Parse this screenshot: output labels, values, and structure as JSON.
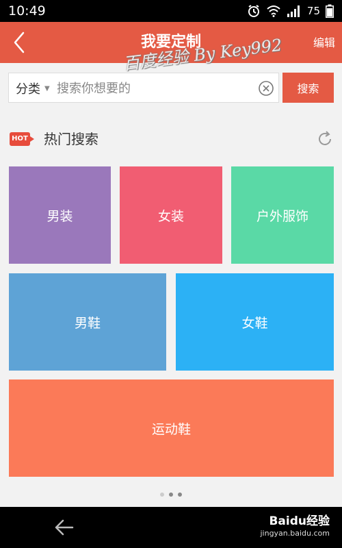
{
  "status_bar": {
    "time": "10:49",
    "battery": "75"
  },
  "header": {
    "title": "我要定制",
    "edit_label": "编辑"
  },
  "search": {
    "category": "分类",
    "placeholder": "搜索你想要的",
    "value": "",
    "button_label": "搜索"
  },
  "hot_section": {
    "badge": "HOT",
    "title": "热门搜索"
  },
  "categories": [
    {
      "label": "男装",
      "color": "#9a78bb"
    },
    {
      "label": "女装",
      "color": "#f15d72"
    },
    {
      "label": "户外服饰",
      "color": "#5ad9a6"
    },
    {
      "label": "男鞋",
      "color": "#5ea3d6"
    },
    {
      "label": "女鞋",
      "color": "#2cb1f5"
    },
    {
      "label": "运动鞋",
      "color": "#fb7a58"
    }
  ],
  "pager": {
    "count": 3,
    "active_index": 0
  },
  "watermark": {
    "text": "百度经验 By Key992"
  },
  "footer_mark": {
    "logo": "Baidu经验",
    "url": "jingyan.baidu.com"
  },
  "colors": {
    "accent": "#e45a44"
  }
}
